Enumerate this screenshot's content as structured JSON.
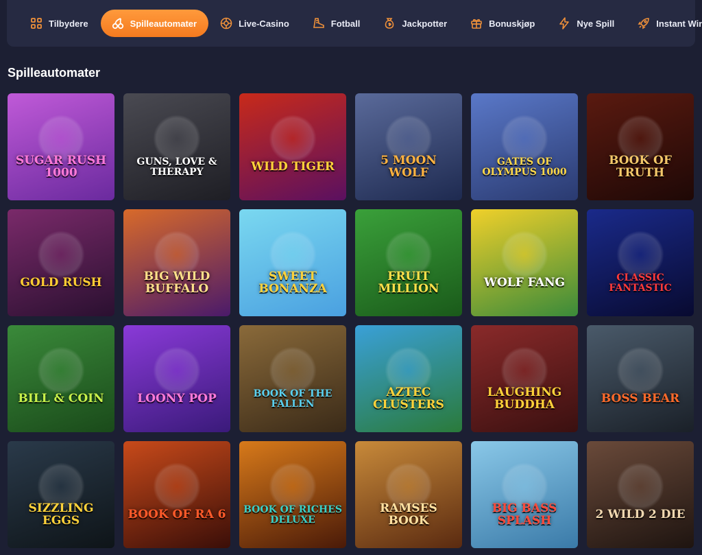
{
  "nav": [
    {
      "label": "Tilbydere",
      "icon": "grid-icon",
      "active": false
    },
    {
      "label": "Spilleautomater",
      "icon": "cherries-icon",
      "active": true
    },
    {
      "label": "Live-Casino",
      "icon": "roulette-icon",
      "active": false
    },
    {
      "label": "Fotball",
      "icon": "boot-icon",
      "active": false
    },
    {
      "label": "Jackpotter",
      "icon": "money-bag-icon",
      "active": false
    },
    {
      "label": "Bonuskjøp",
      "icon": "gift-icon",
      "active": false
    },
    {
      "label": "Nye Spill",
      "icon": "lightning-icon",
      "active": false
    },
    {
      "label": "Instant Win",
      "icon": "rocket-icon",
      "active": false
    }
  ],
  "colors": {
    "accent": "#f5862a",
    "nav_icon": "#f0913a",
    "background": "#1c1f33",
    "nav_bg": "#262a42"
  },
  "section_title": "Spilleautomater",
  "games": [
    {
      "title": "Sugar Rush 1000",
      "bg": [
        "#c05ad8",
        "#6a2a9e"
      ],
      "text": "#ff7ad9"
    },
    {
      "title": "Guns, Love & Therapy",
      "bg": [
        "#4a4a52",
        "#1e1e24"
      ],
      "text": "#ffffff"
    },
    {
      "title": "Wild Tiger",
      "bg": [
        "#c82a1a",
        "#5a1060"
      ],
      "text": "#ffd23a"
    },
    {
      "title": "5 Moon Wolf",
      "bg": [
        "#5a6a9a",
        "#1e2a50"
      ],
      "text": "#ffb340"
    },
    {
      "title": "Gates of Olympus 1000",
      "bg": [
        "#5a78c8",
        "#2a3a70"
      ],
      "text": "#ffd84a"
    },
    {
      "title": "Book of Truth",
      "bg": [
        "#5a1a10",
        "#1e0806"
      ],
      "text": "#f4c86a"
    },
    {
      "title": "Gold Rush",
      "bg": [
        "#7a2a6a",
        "#2a1030"
      ],
      "text": "#ffcc33"
    },
    {
      "title": "Big Wild Buffalo",
      "bg": [
        "#d86a2a",
        "#4a1a6a"
      ],
      "text": "#ffe08a"
    },
    {
      "title": "Sweet Bonanza",
      "bg": [
        "#7ad8f0",
        "#4aa0e0"
      ],
      "text": "#ffd23a"
    },
    {
      "title": "Fruit Million",
      "bg": [
        "#3aa03a",
        "#1a5a1a"
      ],
      "text": "#ffe04a"
    },
    {
      "title": "Wolf Fang",
      "bg": [
        "#f0d02a",
        "#3a8a3a"
      ],
      "text": "#ffffff"
    },
    {
      "title": "Classic Fantastic",
      "bg": [
        "#1a2a8a",
        "#080a30"
      ],
      "text": "#ff3a3a"
    },
    {
      "title": "Bill & Coin",
      "bg": [
        "#3a8a3a",
        "#1a4a1a"
      ],
      "text": "#c8f04a"
    },
    {
      "title": "Loony Pop",
      "bg": [
        "#8a3ad8",
        "#3a1a7a"
      ],
      "text": "#ff7ad9"
    },
    {
      "title": "Book of the Fallen",
      "bg": [
        "#8a6a3a",
        "#3a2a18"
      ],
      "text": "#5ad0f0"
    },
    {
      "title": "Aztec Clusters",
      "bg": [
        "#3aa0d8",
        "#2a7a3a"
      ],
      "text": "#ffd23a"
    },
    {
      "title": "Laughing Buddha",
      "bg": [
        "#8a2a2a",
        "#3a1010"
      ],
      "text": "#ffd23a"
    },
    {
      "title": "Boss Bear",
      "bg": [
        "#4a5a6a",
        "#1a2028"
      ],
      "text": "#ff6a2a"
    },
    {
      "title": "Sizzling Eggs",
      "bg": [
        "#2a3a4a",
        "#0e1418"
      ],
      "text": "#ffd23a"
    },
    {
      "title": "Book of Ra 6",
      "bg": [
        "#c84a1a",
        "#3a0e08"
      ],
      "text": "#ff5a2a"
    },
    {
      "title": "Book of Riches Deluxe",
      "bg": [
        "#d87a1a",
        "#4a1a08"
      ],
      "text": "#3ad0c8"
    },
    {
      "title": "Ramses Book",
      "bg": [
        "#c88a3a",
        "#5a2a10"
      ],
      "text": "#ffe0a0"
    },
    {
      "title": "Big Bass Splash",
      "bg": [
        "#8ac8e8",
        "#3a7aa8"
      ],
      "text": "#ff4a3a"
    },
    {
      "title": "2 Wild 2 Die",
      "bg": [
        "#6a4a3a",
        "#1e1410"
      ],
      "text": "#f0d8b0"
    }
  ]
}
